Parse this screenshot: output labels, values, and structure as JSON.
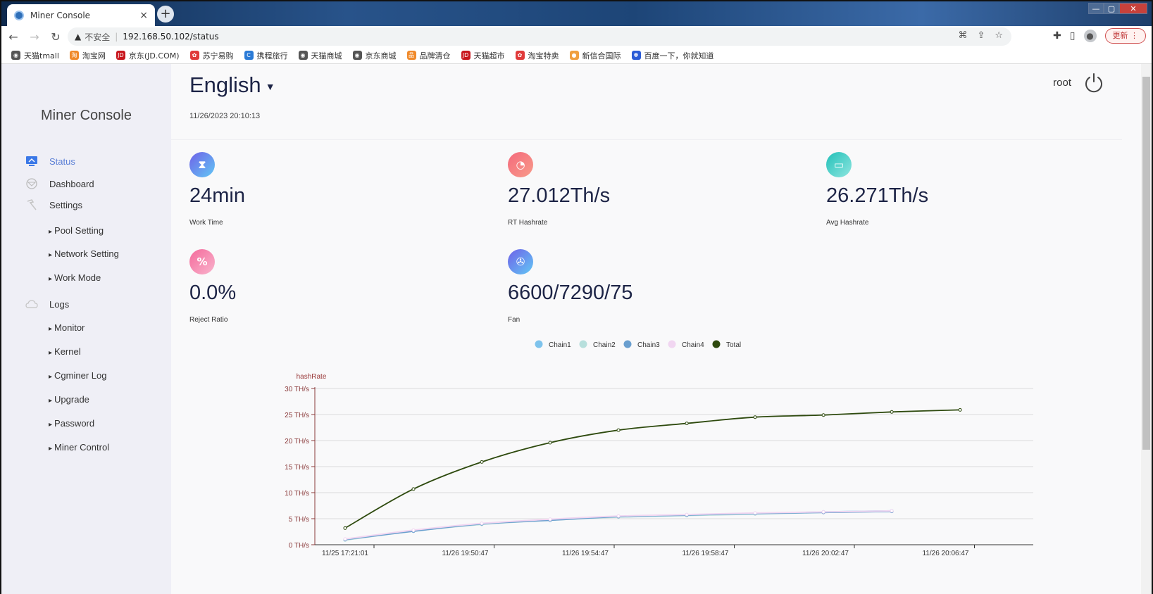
{
  "browser": {
    "tab_title": "Miner Console",
    "tab_close": "×",
    "new_tab": "+",
    "insecure_label": "不安全",
    "url": "192.168.50.102/status",
    "update_button": "更新",
    "bookmarks": [
      {
        "label": "天猫tmall",
        "color": "#555555",
        "glyph": "◉"
      },
      {
        "label": "淘宝网",
        "color": "#f08a2b",
        "glyph": "淘"
      },
      {
        "label": "京东(JD.COM)",
        "color": "#c8161d",
        "glyph": "JD"
      },
      {
        "label": "苏宁易购",
        "color": "#e03a3a",
        "glyph": "✿"
      },
      {
        "label": "携程旅行",
        "color": "#2a7ad6",
        "glyph": "C"
      },
      {
        "label": "天猫商城",
        "color": "#555555",
        "glyph": "◉"
      },
      {
        "label": "京东商城",
        "color": "#555555",
        "glyph": "◉"
      },
      {
        "label": "品牌清仓",
        "color": "#f08a2b",
        "glyph": "品"
      },
      {
        "label": "天猫超市",
        "color": "#c8161d",
        "glyph": "JD"
      },
      {
        "label": "淘宝特卖",
        "color": "#e03a3a",
        "glyph": "✿"
      },
      {
        "label": "新信合国际",
        "color": "#f0a040",
        "glyph": "●"
      },
      {
        "label": "百度一下，你就知道",
        "color": "#2a5bd6",
        "glyph": "✽"
      }
    ]
  },
  "sidebar": {
    "brand": "Miner Console",
    "items": [
      {
        "label": "Status",
        "icon": "monitor-icon",
        "active": true
      },
      {
        "label": "Dashboard",
        "icon": "dashboard-icon",
        "active": false
      },
      {
        "label": "Settings",
        "icon": "hammer-icon",
        "active": false
      },
      {
        "label": "Logs",
        "icon": "cloud-icon",
        "active": false
      }
    ],
    "settings_children": [
      "Pool Setting",
      "Network Setting",
      "Work Mode"
    ],
    "logs_children": [
      "Monitor",
      "Kernel",
      "Cgminer Log",
      "Upgrade",
      "Password",
      "Miner Control"
    ]
  },
  "header": {
    "language": "English",
    "datetime": "11/26/2023 20:10:13",
    "user": "root"
  },
  "stats": [
    {
      "value": "24min",
      "label": "Work Time",
      "icon": "hourglass-icon",
      "glyph": "⧗",
      "gradient": [
        "#6f61e8",
        "#62c8f5"
      ]
    },
    {
      "value": "27.012Th/s",
      "label": "RT Hashrate",
      "icon": "speedometer-icon",
      "glyph": "◔",
      "gradient": [
        "#f4697c",
        "#f89b8a"
      ]
    },
    {
      "value": "26.271Th/s",
      "label": "Avg Hashrate",
      "icon": "server-icon",
      "glyph": "▭",
      "gradient": [
        "#22c0b8",
        "#8fe6e0"
      ]
    },
    {
      "value": "0.0%",
      "label": "Reject Ratio",
      "icon": "percent-icon",
      "glyph": "%",
      "gradient": [
        "#f4699a",
        "#f9b4cd"
      ]
    },
    {
      "value": "6600/7290/75",
      "label": "Fan",
      "icon": "fan-icon",
      "glyph": "✇",
      "gradient": [
        "#6f61e8",
        "#62c8f5"
      ]
    }
  ],
  "chart_data": {
    "type": "line",
    "ylabel": "hashRate",
    "y_unit": " TH/s",
    "ylim": [
      0,
      30
    ],
    "yticks": [
      0,
      5,
      10,
      15,
      20,
      25,
      30
    ],
    "grid": true,
    "legend_position": "top-center",
    "x_labels": [
      "11/25 17:21:01",
      "11/26 19:50:47",
      "11/26 19:54:47",
      "11/26 19:58:47",
      "11/26 20:02:47",
      "11/26 20:06:47"
    ],
    "x_points": 9,
    "series": [
      {
        "name": "Chain1",
        "color": "#7ec3ec",
        "values": [
          1.0,
          2.7,
          4.0,
          4.8,
          5.4,
          5.7,
          6.0,
          6.3,
          6.5
        ]
      },
      {
        "name": "Chain2",
        "color": "#b7dfdc",
        "values": [
          0.9,
          2.6,
          3.9,
          4.7,
          5.3,
          5.6,
          5.9,
          6.2,
          6.4
        ]
      },
      {
        "name": "Chain3",
        "color": "#6a9fcf",
        "values": [
          1.0,
          2.6,
          4.0,
          4.7,
          5.4,
          5.7,
          6.0,
          6.2,
          6.4
        ]
      },
      {
        "name": "Chain4",
        "color": "#f1d6f1",
        "values": [
          1.1,
          2.8,
          4.1,
          4.9,
          5.5,
          5.8,
          6.1,
          6.3,
          6.5
        ]
      },
      {
        "name": "Total",
        "color": "#2e4a0e",
        "values": [
          3.2,
          10.7,
          15.9,
          19.6,
          22.0,
          23.3,
          24.5,
          24.9,
          25.5,
          25.9
        ]
      }
    ]
  }
}
